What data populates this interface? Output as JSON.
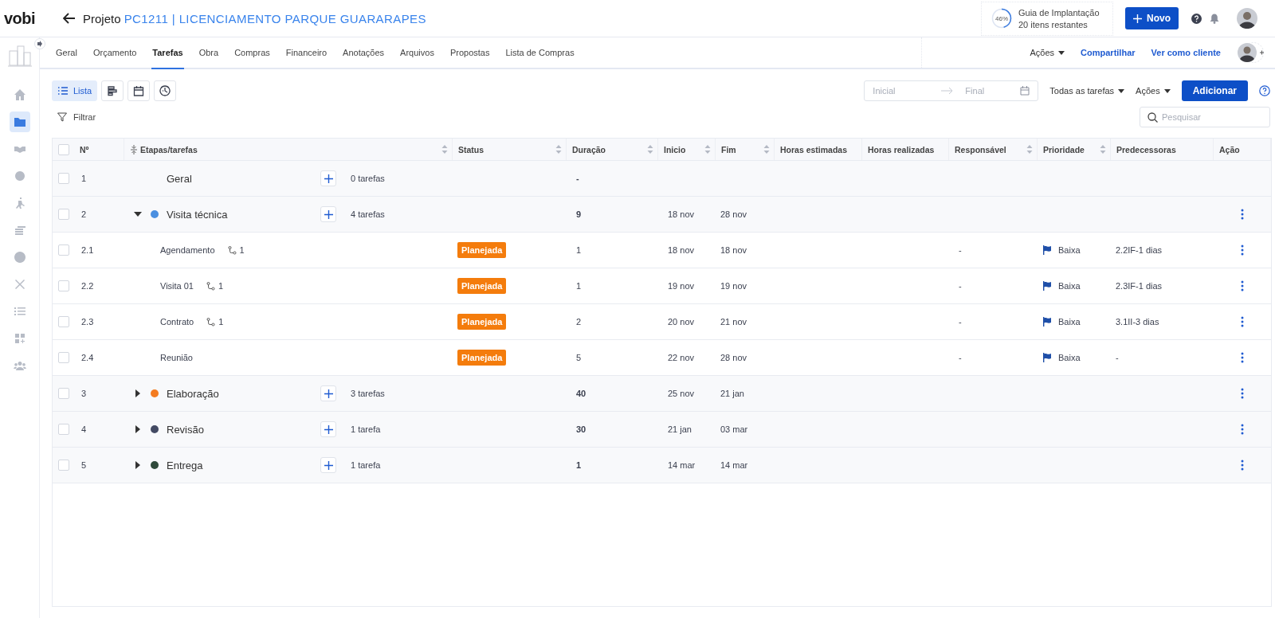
{
  "logo": "vobi",
  "header": {
    "prefix": "Projeto",
    "project": "PC1211 | LICENCIAMENTO PARQUE GUARARAPES"
  },
  "guide": {
    "percent": "46%",
    "title": "Guia de Implantação",
    "subtitle": "20 itens restantes"
  },
  "new_button": "Novo",
  "sidebar": {
    "items": [
      {
        "selected": false
      },
      {
        "selected": true
      },
      {
        "selected": false
      },
      {
        "selected": false
      },
      {
        "selected": false
      },
      {
        "selected": false
      },
      {
        "selected": false
      },
      {
        "selected": false
      },
      {
        "selected": false
      },
      {
        "selected": false
      },
      {
        "selected": false
      }
    ]
  },
  "tabs": [
    {
      "label": "Geral",
      "selected": false
    },
    {
      "label": "Orçamento",
      "selected": false
    },
    {
      "label": "Tarefas",
      "selected": true
    },
    {
      "label": "Obra",
      "selected": false
    },
    {
      "label": "Compras",
      "selected": false
    },
    {
      "label": "Financeiro",
      "selected": false
    },
    {
      "label": "Anotações",
      "selected": false
    },
    {
      "label": "Arquivos",
      "selected": false
    },
    {
      "label": "Propostas",
      "selected": false
    },
    {
      "label": "Lista de Compras",
      "selected": false
    }
  ],
  "tab_actions": {
    "actions": "Ações",
    "share": "Compartilhar",
    "view_as_client": "Ver como cliente"
  },
  "views": [
    {
      "label": "Lista",
      "selected": true
    },
    {
      "selected": false
    },
    {
      "selected": false
    },
    {
      "selected": false
    }
  ],
  "date_range": {
    "start_placeholder": "Inicial",
    "end_placeholder": "Final"
  },
  "task_filter": "Todas as tarefas",
  "actions": "Ações",
  "add_button": "Adicionar",
  "filter": "Filtrar",
  "search": {
    "placeholder": "Pesquisar"
  },
  "table": {
    "select_all": {
      "checked": false
    },
    "columns": [
      {
        "label": "Nº",
        "sortable": false
      },
      {
        "label": "Etapas/tarefas",
        "sortable": true
      },
      {
        "label": "Status",
        "sortable": true
      },
      {
        "label": "Duração",
        "sortable": true
      },
      {
        "label": "Inicio",
        "sortable": true
      },
      {
        "label": "Fim",
        "sortable": true
      },
      {
        "label": "Horas estimadas",
        "sortable": false
      },
      {
        "label": "Horas realizadas",
        "sortable": false
      },
      {
        "label": "Responsável",
        "sortable": true
      },
      {
        "label": "Prioridade",
        "sortable": true
      },
      {
        "label": "Predecessoras",
        "sortable": false
      },
      {
        "label": "Ação",
        "sortable": false
      }
    ],
    "rows": [
      {
        "kind": "stage",
        "checked": false,
        "number": "1",
        "name": "Geral",
        "count": "0 tarefas",
        "duration": "-",
        "menu": false
      },
      {
        "kind": "stage",
        "checked": false,
        "number": "2",
        "name": "Visita técnica",
        "color": "#4a8fe0",
        "expanded": true,
        "count": "4 tarefas",
        "duration": "9",
        "start": "18 nov",
        "end": "28 nov",
        "menu": true
      },
      {
        "kind": "task",
        "checked": false,
        "number": "2.1",
        "name": "Agendamento",
        "links": "1",
        "status": "Planejada",
        "duration": "1",
        "start": "18 nov",
        "end": "18 nov",
        "responsible": "-",
        "priority": "Baixa",
        "predecessors": "2.2IF-1 dias",
        "menu": true
      },
      {
        "kind": "task",
        "checked": false,
        "number": "2.2",
        "name": "Visita 01",
        "links": "1",
        "status": "Planejada",
        "duration": "1",
        "start": "19 nov",
        "end": "19 nov",
        "responsible": "-",
        "priority": "Baixa",
        "predecessors": "2.3IF-1 dias",
        "menu": true
      },
      {
        "kind": "task",
        "checked": false,
        "number": "2.3",
        "name": "Contrato",
        "links": "1",
        "status": "Planejada",
        "duration": "2",
        "start": "20 nov",
        "end": "21 nov",
        "responsible": "-",
        "priority": "Baixa",
        "predecessors": "3.1II-3 dias",
        "menu": true
      },
      {
        "kind": "task",
        "checked": false,
        "number": "2.4",
        "name": "Reunião",
        "status": "Planejada",
        "duration": "5",
        "start": "22 nov",
        "end": "28 nov",
        "responsible": "-",
        "priority": "Baixa",
        "predecessors": "-",
        "menu": true
      },
      {
        "kind": "stage",
        "checked": false,
        "number": "3",
        "name": "Elaboração",
        "color": "#f47c20",
        "expanded": false,
        "count": "3 tarefas",
        "duration": "40",
        "start": "25 nov",
        "end": "21 jan",
        "menu": true
      },
      {
        "kind": "stage",
        "checked": false,
        "number": "4",
        "name": "Revisão",
        "color": "#434a63",
        "expanded": false,
        "count": "1 tarefa",
        "duration": "30",
        "start": "21 jan",
        "end": "03 mar",
        "menu": true
      },
      {
        "kind": "stage",
        "checked": false,
        "number": "5",
        "name": "Entrega",
        "color": "#2f4a3b",
        "expanded": false,
        "count": "1 tarefa",
        "duration": "1",
        "start": "14 mar",
        "end": "14 mar",
        "menu": true
      }
    ]
  }
}
